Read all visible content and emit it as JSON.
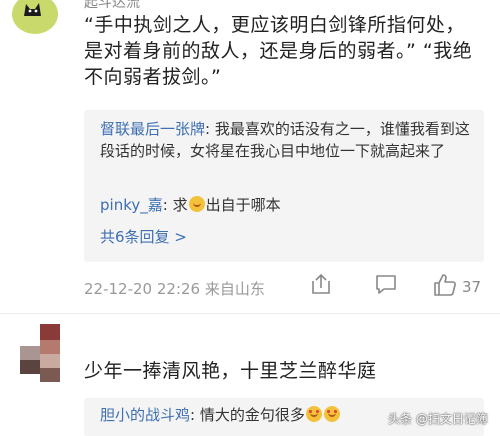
{
  "top_comment": {
    "username_partial": "起斗达流",
    "text": "“手中执剑之人，更应该明白剑锋所指何处，是对着身前的敌人，还是身后的弱者。” “我绝不向弱者拔剑。”"
  },
  "replies": [
    {
      "name": "督联最后一张牌",
      "text": "我最喜欢的话没有之一，谁懂我看到这段话的时候，女将星在我心目中地位一下就高起来了"
    },
    {
      "name": "pinky_嘉",
      "text_before": "求",
      "emoji": "laugh-emoji",
      "text_after": "出自于哪本"
    }
  ],
  "more_replies": "共6条回复 >",
  "meta": {
    "timestamp": "22-12-20 22:26",
    "location": "来自山东",
    "likes": "37"
  },
  "second_comment": {
    "text": "少年一捧清风艳，十里芝兰醉华庭",
    "reply": {
      "name": "胆小的战斗鸡",
      "text": "情大的金句很多"
    }
  },
  "watermark": "头条 @扫文日记簿",
  "colors": {
    "link_blue": "#3e6fb3",
    "reply_bg": "#f4f4f4",
    "meta_gray": "#999999",
    "avatar_bg": "#c9d96b"
  }
}
